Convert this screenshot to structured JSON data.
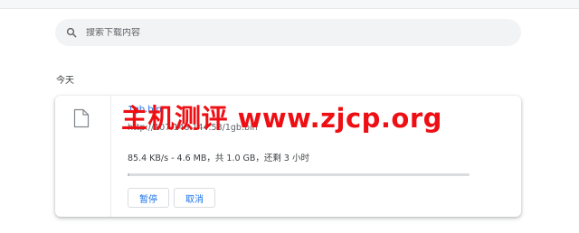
{
  "search": {
    "placeholder": "搜索下载内容"
  },
  "sections": [
    {
      "date_label": "今天",
      "downloads": [
        {
          "file_name": "1gb.bin",
          "url": "http://107.148.144.53/1gb.bin",
          "status": "85.4 KB/s - 4.6 MB，共 1.0 GB，还剩 3 小时",
          "progress_fraction": 0.0046,
          "actions": {
            "pause_label": "暂停",
            "cancel_label": "取消"
          },
          "file_icon": "document-icon"
        }
      ]
    }
  ],
  "watermark": {
    "text": "主机测评 www.zjcp.org",
    "color": "#ee0f14"
  },
  "colors": {
    "accent": "#1a73e8",
    "search_background": "#f1f3f4",
    "secondary_text": "#5f6368"
  }
}
